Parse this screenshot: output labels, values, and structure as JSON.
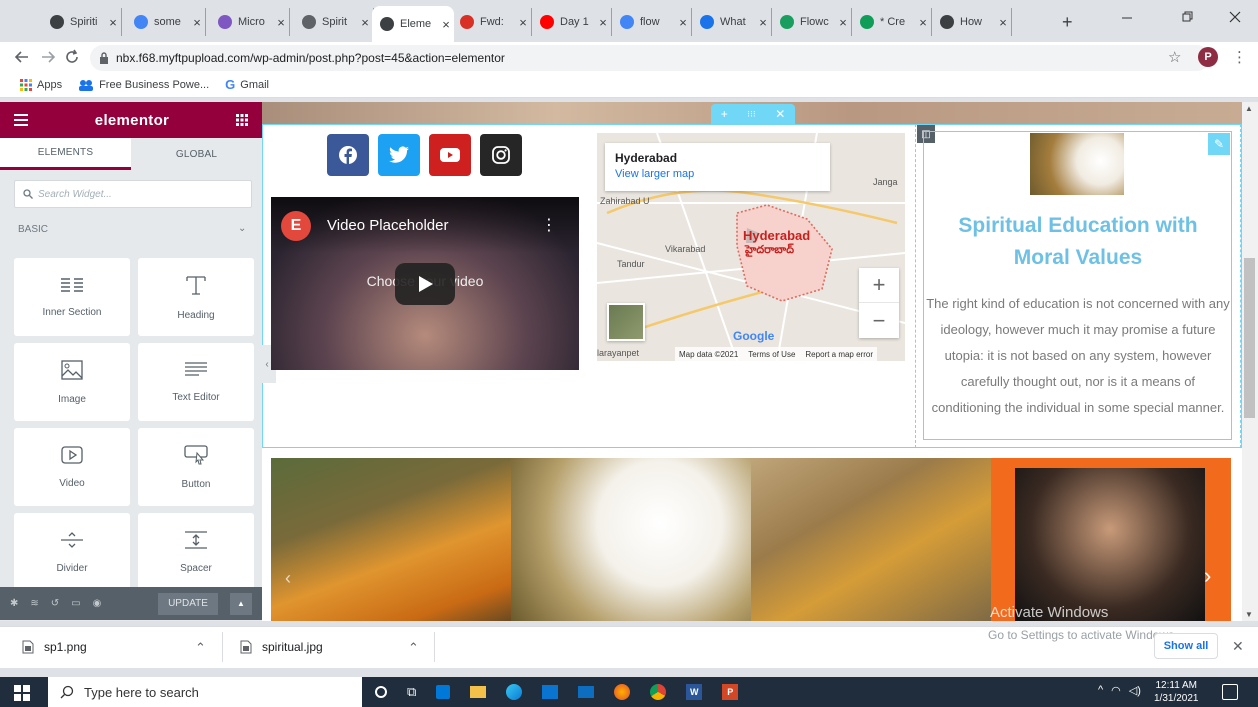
{
  "browser": {
    "tabs": [
      {
        "label": "Spiriti",
        "favicon": "globe-icon",
        "color": "#3c4043"
      },
      {
        "label": "some",
        "favicon": "google-icon",
        "color": "#4285f4"
      },
      {
        "label": "Micro",
        "favicon": "microsoft-icon",
        "color": "#7e57c2"
      },
      {
        "label": "Spirit",
        "favicon": "spiritual-icon",
        "color": "#5f6368"
      },
      {
        "label": "Eleme",
        "favicon": "globe-icon",
        "color": "#3c4043",
        "active": true
      },
      {
        "label": "Fwd:",
        "favicon": "gmail-icon",
        "color": "#d93025"
      },
      {
        "label": "Day 1",
        "favicon": "youtube-icon",
        "color": "#ff0000"
      },
      {
        "label": "flow",
        "favicon": "google-icon",
        "color": "#4285f4"
      },
      {
        "label": "What",
        "favicon": "flowchart-icon",
        "color": "#1a73e8"
      },
      {
        "label": "Flowc",
        "favicon": "flowchart-icon",
        "color": "#1a9e5f"
      },
      {
        "label": "* Cre",
        "favicon": "document-icon",
        "color": "#0f9d58"
      },
      {
        "label": "How",
        "favicon": "globe-icon",
        "color": "#3c4043"
      }
    ],
    "new_tab": "+",
    "url": "nbx.f68.myftpupload.com/wp-admin/post.php?post=45&action=elementor",
    "profile_initial": "P",
    "bookmarks": [
      "Apps",
      "Free Business Powe...",
      "Gmail"
    ]
  },
  "elementor": {
    "title": "elementor",
    "tabs": [
      "ELEMENTS",
      "GLOBAL"
    ],
    "search_placeholder": "Search Widget...",
    "category": "BASIC",
    "widgets": [
      "Inner Section",
      "Heading",
      "Image",
      "Text Editor",
      "Video",
      "Button",
      "Divider",
      "Spacer"
    ],
    "update_label": "UPDATE"
  },
  "canvas": {
    "video_title": "Video Placeholder",
    "video_overlay": "Choose your video",
    "map": {
      "place": "Hyderabad",
      "larger_link": "View larger map",
      "footer": [
        "Map data ©2021",
        "Terms of Use",
        "Report a map error"
      ],
      "labels": [
        "Zahirabad U",
        "Tandur",
        "Vikarabad",
        "Hyderabad",
        "హైదరాబాద్",
        "Janga",
        "Google",
        "larayanpet"
      ]
    },
    "heading": "Spiritual Education with Moral Values",
    "body": "The right kind of education is not concerned with any ideology, however much it may promise a future utopia: it is not based on any system, however carefully thought out, nor is it a means of conditioning the individual in some special manner."
  },
  "downloads": {
    "items": [
      "sp1.png",
      "spiritual.jpg"
    ],
    "show_all": "Show all"
  },
  "watermark": {
    "line1": "Activate Windows",
    "line2": "Go to Settings to activate Windows."
  },
  "taskbar": {
    "search_placeholder": "Type here to search",
    "time": "12:11 AM",
    "date": "1/31/2021"
  },
  "colors": {
    "elementor": "#93003c",
    "heading": "#6ec1e4",
    "selection": "#71d7f7"
  }
}
